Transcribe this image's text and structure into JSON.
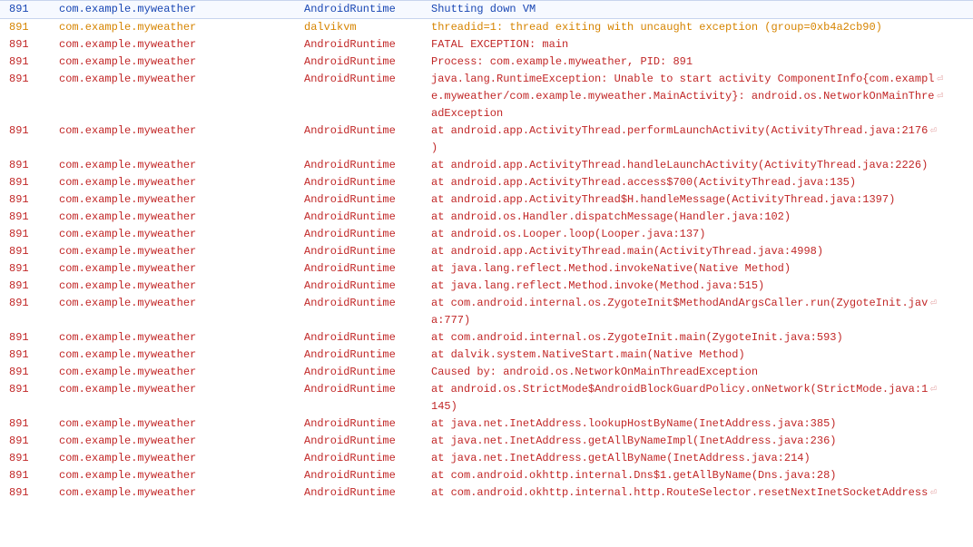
{
  "wrap_glyph": "⏎",
  "log": {
    "rows": [
      {
        "level": "info",
        "pid": "891",
        "pkg": "com.example.myweather",
        "tag": "AndroidRuntime",
        "msg": [
          "Shutting down VM"
        ]
      },
      {
        "level": "warn",
        "pid": "891",
        "pkg": "com.example.myweather",
        "tag": "dalvikvm",
        "msg": [
          "threadid=1: thread exiting with uncaught exception (group=0xb4a2cb90)"
        ]
      },
      {
        "level": "error",
        "pid": "891",
        "pkg": "com.example.myweather",
        "tag": "AndroidRuntime",
        "msg": [
          "FATAL EXCEPTION: main"
        ]
      },
      {
        "level": "error",
        "pid": "891",
        "pkg": "com.example.myweather",
        "tag": "AndroidRuntime",
        "msg": [
          "Process: com.example.myweather, PID: 891"
        ]
      },
      {
        "level": "error",
        "pid": "891",
        "pkg": "com.example.myweather",
        "tag": "AndroidRuntime",
        "msg": [
          "java.lang.RuntimeException: Unable to start activity ComponentInfo{com.exampl",
          "e.myweather/com.example.myweather.MainActivity}: android.os.NetworkOnMainThre",
          "adException"
        ]
      },
      {
        "level": "error",
        "pid": "891",
        "pkg": "com.example.myweather",
        "tag": "AndroidRuntime",
        "msg": [
          "at android.app.ActivityThread.performLaunchActivity(ActivityThread.java:2176",
          ")"
        ]
      },
      {
        "level": "error",
        "pid": "891",
        "pkg": "com.example.myweather",
        "tag": "AndroidRuntime",
        "msg": [
          "at android.app.ActivityThread.handleLaunchActivity(ActivityThread.java:2226)"
        ]
      },
      {
        "level": "error",
        "pid": "891",
        "pkg": "com.example.myweather",
        "tag": "AndroidRuntime",
        "msg": [
          "at android.app.ActivityThread.access$700(ActivityThread.java:135)"
        ]
      },
      {
        "level": "error",
        "pid": "891",
        "pkg": "com.example.myweather",
        "tag": "AndroidRuntime",
        "msg": [
          "at android.app.ActivityThread$H.handleMessage(ActivityThread.java:1397)"
        ]
      },
      {
        "level": "error",
        "pid": "891",
        "pkg": "com.example.myweather",
        "tag": "AndroidRuntime",
        "msg": [
          "at android.os.Handler.dispatchMessage(Handler.java:102)"
        ]
      },
      {
        "level": "error",
        "pid": "891",
        "pkg": "com.example.myweather",
        "tag": "AndroidRuntime",
        "msg": [
          "at android.os.Looper.loop(Looper.java:137)"
        ]
      },
      {
        "level": "error",
        "pid": "891",
        "pkg": "com.example.myweather",
        "tag": "AndroidRuntime",
        "msg": [
          "at android.app.ActivityThread.main(ActivityThread.java:4998)"
        ]
      },
      {
        "level": "error",
        "pid": "891",
        "pkg": "com.example.myweather",
        "tag": "AndroidRuntime",
        "msg": [
          "at java.lang.reflect.Method.invokeNative(Native Method)"
        ]
      },
      {
        "level": "error",
        "pid": "891",
        "pkg": "com.example.myweather",
        "tag": "AndroidRuntime",
        "msg": [
          "at java.lang.reflect.Method.invoke(Method.java:515)"
        ]
      },
      {
        "level": "error",
        "pid": "891",
        "pkg": "com.example.myweather",
        "tag": "AndroidRuntime",
        "msg": [
          "at com.android.internal.os.ZygoteInit$MethodAndArgsCaller.run(ZygoteInit.jav",
          "a:777)"
        ]
      },
      {
        "level": "error",
        "pid": "891",
        "pkg": "com.example.myweather",
        "tag": "AndroidRuntime",
        "msg": [
          "at com.android.internal.os.ZygoteInit.main(ZygoteInit.java:593)"
        ]
      },
      {
        "level": "error",
        "pid": "891",
        "pkg": "com.example.myweather",
        "tag": "AndroidRuntime",
        "msg": [
          "at dalvik.system.NativeStart.main(Native Method)"
        ]
      },
      {
        "level": "error",
        "pid": "891",
        "pkg": "com.example.myweather",
        "tag": "AndroidRuntime",
        "msg": [
          "Caused by: android.os.NetworkOnMainThreadException"
        ]
      },
      {
        "level": "error",
        "pid": "891",
        "pkg": "com.example.myweather",
        "tag": "AndroidRuntime",
        "msg": [
          "at android.os.StrictMode$AndroidBlockGuardPolicy.onNetwork(StrictMode.java:1",
          "145)"
        ]
      },
      {
        "level": "error",
        "pid": "891",
        "pkg": "com.example.myweather",
        "tag": "AndroidRuntime",
        "msg": [
          "at java.net.InetAddress.lookupHostByName(InetAddress.java:385)"
        ]
      },
      {
        "level": "error",
        "pid": "891",
        "pkg": "com.example.myweather",
        "tag": "AndroidRuntime",
        "msg": [
          "at java.net.InetAddress.getAllByNameImpl(InetAddress.java:236)"
        ]
      },
      {
        "level": "error",
        "pid": "891",
        "pkg": "com.example.myweather",
        "tag": "AndroidRuntime",
        "msg": [
          "at java.net.InetAddress.getAllByName(InetAddress.java:214)"
        ]
      },
      {
        "level": "error",
        "pid": "891",
        "pkg": "com.example.myweather",
        "tag": "AndroidRuntime",
        "msg": [
          "at com.android.okhttp.internal.Dns$1.getAllByName(Dns.java:28)"
        ]
      },
      {
        "level": "error",
        "pid": "891",
        "pkg": "com.example.myweather",
        "tag": "AndroidRuntime",
        "msg": [
          "at com.android.okhttp.internal.http.RouteSelector.resetNextInetSocketAddress"
        ]
      }
    ]
  }
}
